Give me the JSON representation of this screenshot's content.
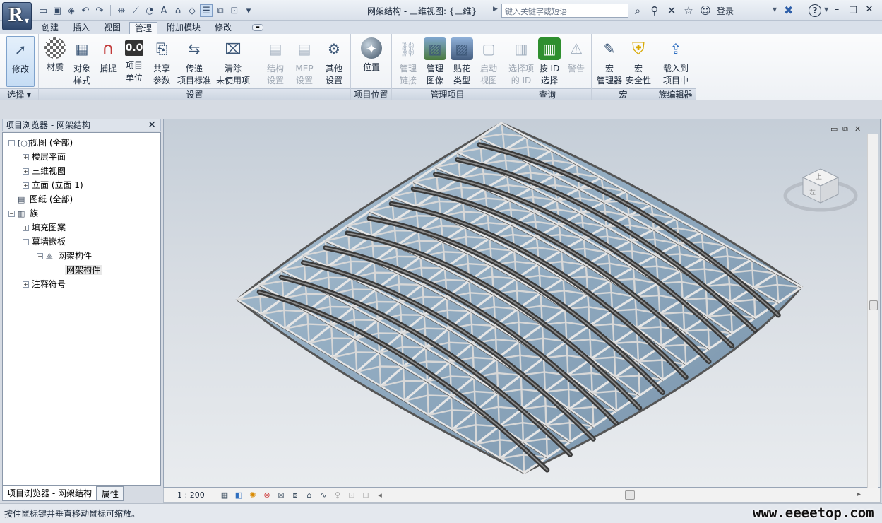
{
  "title": {
    "window_title": "网架结构 - 三维视图: {三维}",
    "search_placeholder": "键入关键字或短语",
    "login_label": "登录"
  },
  "tabs": [
    "创建",
    "插入",
    "视图",
    "管理",
    "附加模块",
    "修改"
  ],
  "active_tab": "管理",
  "ribbon": {
    "select": {
      "title": "选择",
      "modify": "修改"
    },
    "settings": {
      "title": "设置",
      "buttons": [
        {
          "l1": "材质",
          "l2": ""
        },
        {
          "l1": "对象",
          "l2": "样式"
        },
        {
          "l1": "捕捉",
          "l2": ""
        },
        {
          "l1": "项目",
          "l2": "单位"
        },
        {
          "l1": "共享",
          "l2": "参数"
        },
        {
          "l1": "传递",
          "l2": "项目标准"
        },
        {
          "l1": "清除",
          "l2": "未使用项"
        },
        {
          "l1": "结构",
          "l2": "设置"
        },
        {
          "l1": "MEP",
          "l2": "设置"
        },
        {
          "l1": "其他",
          "l2": "设置"
        }
      ],
      "icon_text": "0.0"
    },
    "location": {
      "title": "项目位置",
      "button": "位置"
    },
    "manage_project": {
      "title": "管理项目",
      "buttons": [
        {
          "l1": "管理",
          "l2": "链接"
        },
        {
          "l1": "管理",
          "l2": "图像"
        },
        {
          "l1": "贴花",
          "l2": "类型"
        },
        {
          "l1": "启动",
          "l2": "视图"
        }
      ]
    },
    "inquiry": {
      "title": "查询",
      "buttons": [
        {
          "l1": "选择项",
          "l2": "的 ID"
        },
        {
          "l1": "按 ID",
          "l2": "选择"
        },
        {
          "l1": "警告",
          "l2": ""
        }
      ]
    },
    "macros": {
      "title": "宏",
      "buttons": [
        {
          "l1": "宏",
          "l2": "管理器"
        },
        {
          "l1": "宏",
          "l2": "安全性"
        }
      ]
    },
    "family_editor": {
      "title": "族编辑器",
      "button": {
        "l1": "载入到",
        "l2": "项目中"
      }
    }
  },
  "project_browser": {
    "header": "项目浏览器 - 网架结构",
    "tree": [
      {
        "label": "视图 (全部)",
        "icon": "view-icon",
        "expander": "−"
      },
      {
        "label": "楼层平面",
        "icon": "",
        "expander": "+"
      },
      {
        "label": "三维视图",
        "icon": "",
        "expander": "+"
      },
      {
        "label": "立面 (立面 1)",
        "icon": "",
        "expander": "+"
      },
      {
        "label": "图纸 (全部)",
        "icon": "sheet-icon",
        "expander": ""
      },
      {
        "label": "族",
        "icon": "family-icon",
        "expander": "−"
      },
      {
        "label": "填充图案",
        "icon": "",
        "expander": "+"
      },
      {
        "label": "幕墙嵌板",
        "icon": "",
        "expander": "−"
      },
      {
        "label": "网架构件",
        "icon": "curtain-panel-icon",
        "expander": "−"
      },
      {
        "label": "网架构件",
        "icon": "",
        "expander": ""
      },
      {
        "label": "注释符号",
        "icon": "",
        "expander": "+"
      }
    ],
    "bottom_tabs": [
      "项目浏览器 - 网架结构",
      "属性"
    ]
  },
  "viewcube": {
    "top_label": "上",
    "front_label": "左"
  },
  "view_control": {
    "scale": "1 : 200"
  },
  "status": {
    "text": "按住鼠标键并垂直移动鼠标可缩放。"
  },
  "watermark": "www.eeeetop.com",
  "colors": {
    "ribbon_bg": "#eef1f5",
    "canvas_bg": "#d8dde3",
    "glass": "#8fa9bf",
    "tube_light": "#e8e8e8",
    "tube_dark": "#3a3a3a"
  }
}
